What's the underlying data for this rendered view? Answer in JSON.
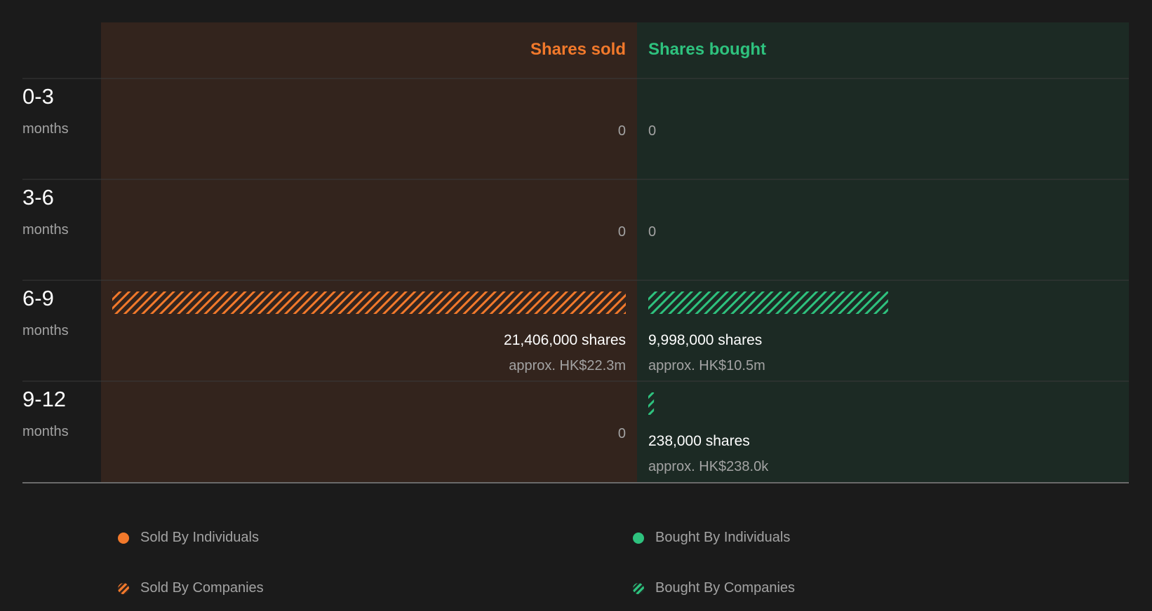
{
  "colors": {
    "background": "#1b1b1b",
    "sold_panel": "#33241d",
    "bought_panel": "#1c2a24",
    "sold_accent": "#f2792b",
    "bought_accent": "#2ec27e",
    "row_text": "#ffffff",
    "muted_text": "#a3a3a3",
    "divider": "#3a3a3a"
  },
  "chart_data": {
    "type": "bar",
    "columns": {
      "sold": "Shares sold",
      "bought": "Shares bought"
    },
    "rows": [
      {
        "period": "0-3",
        "unit": "months",
        "sold_shares": 0,
        "bought_shares": 0,
        "sold_label": "0",
        "bought_label": "0",
        "sold_value": "",
        "bought_value": ""
      },
      {
        "period": "3-6",
        "unit": "months",
        "sold_shares": 0,
        "bought_shares": 0,
        "sold_label": "0",
        "bought_label": "0",
        "sold_value": "",
        "bought_value": ""
      },
      {
        "period": "6-9",
        "unit": "months",
        "sold_shares": 21406000,
        "bought_shares": 9998000,
        "sold_label": "21,406,000 shares",
        "bought_label": "9,998,000 shares",
        "sold_value": "approx. HK$22.3m",
        "bought_value": "approx. HK$10.5m"
      },
      {
        "period": "9-12",
        "unit": "months",
        "sold_shares": 0,
        "bought_shares": 238000,
        "sold_label": "0",
        "bought_label": "238,000 shares",
        "sold_value": "",
        "bought_value": "approx. HK$238.0k"
      }
    ],
    "series": [
      {
        "name": "Sold By Individuals",
        "side": "sold",
        "type": "individual"
      },
      {
        "name": "Sold By Companies",
        "side": "sold",
        "type": "company"
      },
      {
        "name": "Bought By Individuals",
        "side": "bought",
        "type": "individual"
      },
      {
        "name": "Bought By Companies",
        "side": "bought",
        "type": "company"
      }
    ],
    "bar_series": {
      "sold": "company",
      "bought": "company"
    },
    "max_shares": 21406000,
    "legend_position": "bottom"
  }
}
